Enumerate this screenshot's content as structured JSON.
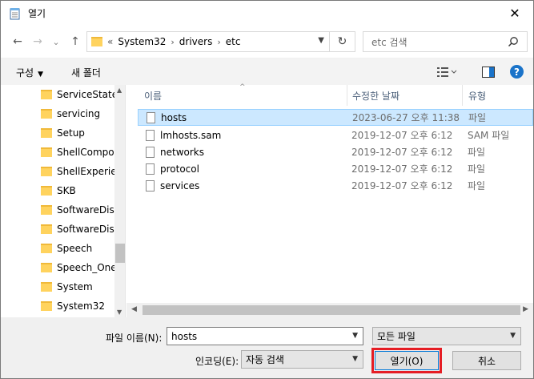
{
  "window": {
    "title": "열기",
    "close_glyph": "✕"
  },
  "nav": {
    "back_glyph": "←",
    "forward_glyph": "→",
    "recent_glyph": "⌄",
    "up_glyph": "↑",
    "breadcrumb": {
      "overflow": "«",
      "items": [
        "System32",
        "drivers",
        "etc"
      ],
      "separator": "›"
    },
    "refresh_glyph": "↻",
    "search": {
      "placeholder": "etc 검색"
    }
  },
  "toolbar": {
    "organize": "구성",
    "new_folder": "새 폴더",
    "help_glyph": "?"
  },
  "sidebar": {
    "items": [
      {
        "label": "ServiceState"
      },
      {
        "label": "servicing"
      },
      {
        "label": "Setup"
      },
      {
        "label": "ShellCompon"
      },
      {
        "label": "ShellExperien"
      },
      {
        "label": "SKB"
      },
      {
        "label": "SoftwareDistr"
      },
      {
        "label": "SoftwareDistr"
      },
      {
        "label": "Speech"
      },
      {
        "label": "Speech_OneC"
      },
      {
        "label": "System"
      },
      {
        "label": "System32"
      }
    ]
  },
  "filelist": {
    "columns": {
      "name": "이름",
      "date": "수정한 날짜",
      "type": "유형"
    },
    "sort_glyph": "^",
    "files": [
      {
        "name": "hosts",
        "date": "2023-06-27 오후 11:38",
        "type": "파일",
        "selected": true
      },
      {
        "name": "lmhosts.sam",
        "date": "2019-12-07 오후 6:12",
        "type": "SAM 파일",
        "selected": false
      },
      {
        "name": "networks",
        "date": "2019-12-07 오후 6:12",
        "type": "파일",
        "selected": false
      },
      {
        "name": "protocol",
        "date": "2019-12-07 오후 6:12",
        "type": "파일",
        "selected": false
      },
      {
        "name": "services",
        "date": "2019-12-07 오후 6:12",
        "type": "파일",
        "selected": false
      }
    ]
  },
  "bottom": {
    "filename_label": "파일 이름(N):",
    "filename_value": "hosts",
    "filetype_value": "모든 파일",
    "encoding_label": "인코딩(E):",
    "encoding_value": "자동 검색",
    "open_button": "열기(O)",
    "cancel_button": "취소"
  },
  "colors": {
    "selection": "#cce8ff",
    "focus_outline": "#e51d24",
    "help": "#1a73c9"
  }
}
